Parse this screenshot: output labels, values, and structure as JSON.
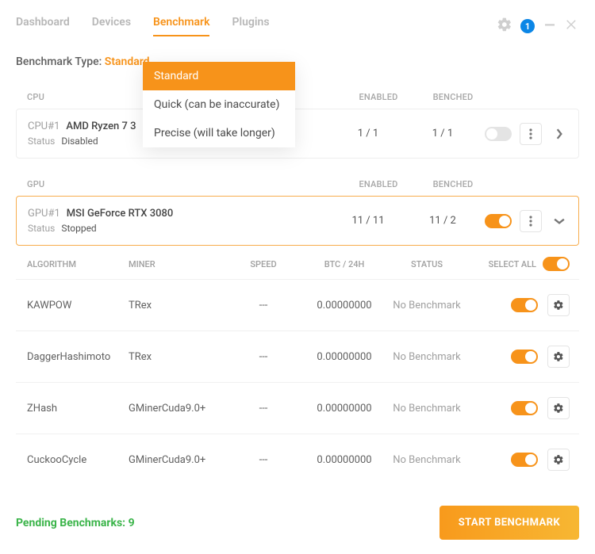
{
  "nav": {
    "items": [
      {
        "label": "Dashboard",
        "active": false
      },
      {
        "label": "Devices",
        "active": false
      },
      {
        "label": "Benchmark",
        "active": true
      },
      {
        "label": "Plugins",
        "active": false
      }
    ],
    "badge": "1"
  },
  "benchmark_type": {
    "label": "Benchmark Type:",
    "value": "Standard",
    "options": [
      "Standard",
      "Quick (can be inaccurate)",
      "Precise (will take longer)"
    ]
  },
  "sections": {
    "cpu_label": "CPU",
    "gpu_label": "GPU",
    "enabled_label": "ENABLED",
    "benched_label": "BENCHED"
  },
  "devices": {
    "cpu": {
      "tag": "CPU#1",
      "name": "AMD Ryzen 7 3",
      "status_label": "Status",
      "status_value": "Disabled",
      "enabled": "1 / 1",
      "benched": "1 / 1",
      "toggle_on": false,
      "expanded": false
    },
    "gpu": {
      "tag": "GPU#1",
      "name": "MSI GeForce RTX 3080",
      "status_label": "Status",
      "status_value": "Stopped",
      "enabled": "11 / 11",
      "benched": "11 / 2",
      "toggle_on": true,
      "expanded": true
    }
  },
  "algo_header": {
    "algorithm": "ALGORITHM",
    "miner": "MINER",
    "speed": "SPEED",
    "btc": "BTC / 24H",
    "status": "STATUS",
    "select_all": "SELECT ALL",
    "select_all_on": true
  },
  "algorithms": [
    {
      "name": "KAWPOW",
      "miner": "TRex",
      "speed": "---",
      "btc": "0.00000000",
      "status": "No Benchmark",
      "on": true
    },
    {
      "name": "DaggerHashimoto",
      "miner": "TRex",
      "speed": "---",
      "btc": "0.00000000",
      "status": "No Benchmark",
      "on": true
    },
    {
      "name": "ZHash",
      "miner": "GMinerCuda9.0+",
      "speed": "---",
      "btc": "0.00000000",
      "status": "No Benchmark",
      "on": true
    },
    {
      "name": "CuckooCycle",
      "miner": "GMinerCuda9.0+",
      "speed": "---",
      "btc": "0.00000000",
      "status": "No Benchmark",
      "on": true
    }
  ],
  "footer": {
    "pending": "Pending Benchmarks: 9",
    "start": "START BENCHMARK"
  },
  "colors": {
    "accent": "#f7931a",
    "green": "#3bb44a",
    "blue": "#0b86e6"
  }
}
